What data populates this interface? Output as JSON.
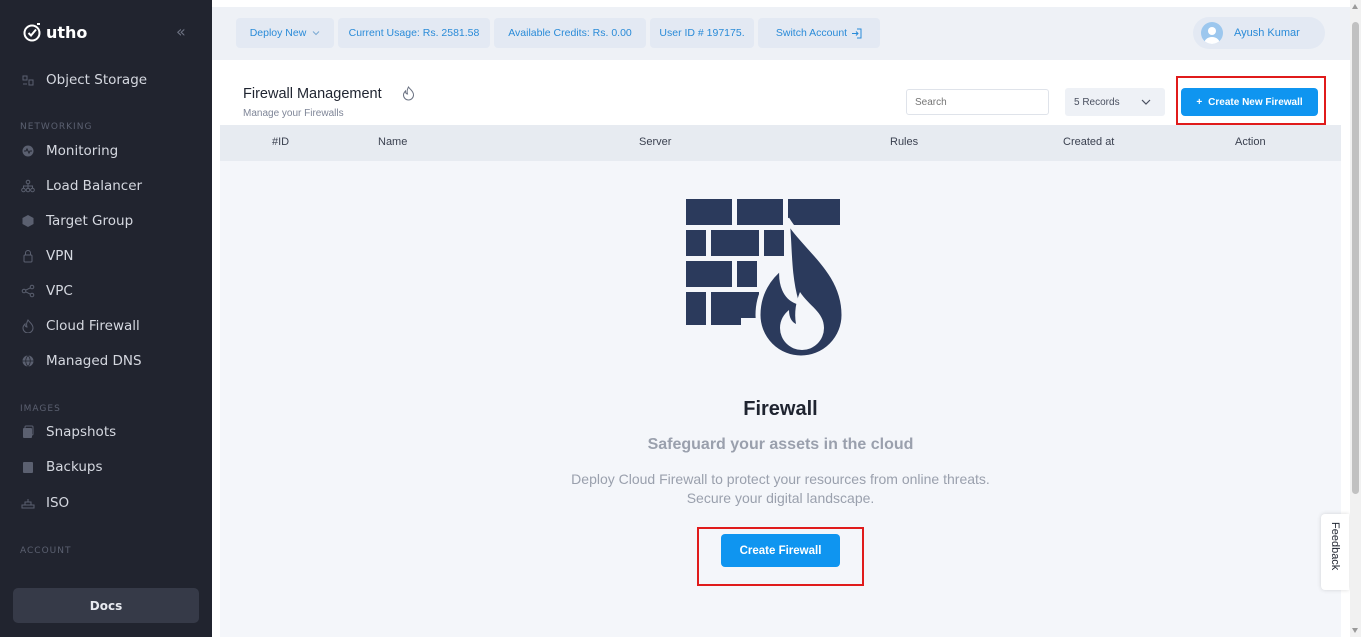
{
  "brand": {
    "name": "utho"
  },
  "sidebar": {
    "items": [
      {
        "label": "Object Storage",
        "icon": "object-storage-icon"
      },
      {
        "label": "Monitoring",
        "icon": "monitoring-icon"
      },
      {
        "label": "Load Balancer",
        "icon": "load-balancer-icon"
      },
      {
        "label": "Target Group",
        "icon": "target-group-icon"
      },
      {
        "label": "VPN",
        "icon": "lock-icon"
      },
      {
        "label": "VPC",
        "icon": "share-icon"
      },
      {
        "label": "Cloud Firewall",
        "icon": "flame-icon"
      },
      {
        "label": "Managed DNS",
        "icon": "globe-icon"
      },
      {
        "label": "Snapshots",
        "icon": "snapshot-icon"
      },
      {
        "label": "Backups",
        "icon": "backup-icon"
      },
      {
        "label": "ISO",
        "icon": "disc-icon"
      }
    ],
    "sections": {
      "networking": "NETWORKING",
      "images": "IMAGES",
      "account": "ACCOUNT"
    },
    "docs_label": "Docs"
  },
  "topbar": {
    "deploy_new": "Deploy New",
    "current_usage": "Current Usage: Rs. 2581.58",
    "available_credits": "Available Credits: Rs. 0.00",
    "user_id": "User ID # 197175.",
    "switch_account": "Switch Account",
    "user_name": "Ayush Kumar"
  },
  "page": {
    "title": "Firewall Management",
    "subtitle": "Manage your Firewalls",
    "search_placeholder": "Search",
    "records": "5 Records",
    "create_new_label": "Create New Firewall",
    "create_new_prefix": "+"
  },
  "table": {
    "columns": [
      "#ID",
      "Name",
      "Server",
      "Rules",
      "Created at",
      "Action"
    ]
  },
  "empty_state": {
    "title": "Firewall",
    "subtitle": "Safeguard your assets in the cloud",
    "description_line1": "Deploy Cloud Firewall to protect your resources from online threats.",
    "description_line2": "Secure your digital landscape.",
    "button": "Create Firewall"
  },
  "feedback": {
    "label": "Feedback"
  },
  "colors": {
    "accent": "#0f95f0",
    "sidebar_bg": "#21242f",
    "highlight": "#e01b1b",
    "illustration": "#2b3a5c"
  }
}
